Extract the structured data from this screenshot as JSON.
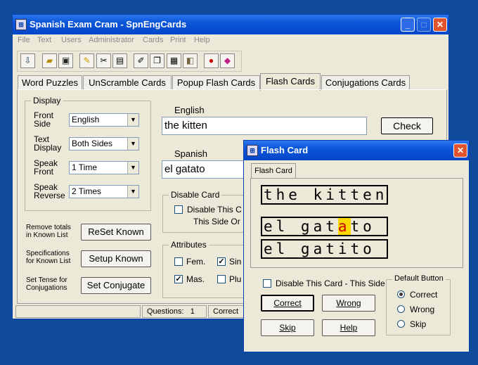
{
  "main": {
    "title": "Spanish Exam Cram - SpnEngCards",
    "menu": [
      "File",
      "Text",
      "Users",
      "Administrator",
      "Cards",
      "Print",
      "Help"
    ],
    "tabs": [
      "Word Puzzles",
      "UnScramble Cards",
      "Popup Flash Cards",
      "Flash Cards",
      "Conjugations Cards"
    ],
    "display": {
      "label": "Display",
      "front_side_label": "Front\nSide",
      "front_side_value": "English",
      "text_display_label": "Text\nDisplay",
      "text_display_value": "Both Sides",
      "speak_front_label": "Speak\nFront",
      "speak_front_value": "1 Time",
      "speak_reverse_label": "Speak\nReverse",
      "speak_reverse_value": "2 Times"
    },
    "known": {
      "remove_label": "Remove totals\nin Known List",
      "reset_button": "ReSet Known",
      "spec_label": "Specifications\nfor Known List",
      "setup_button": "Setup Known",
      "tense_label": "Set Tense for\nConjugations",
      "conjugate_button": "Set Conjugate"
    },
    "english_label": "English",
    "english_value": "the kitten",
    "check_button": "Check",
    "spanish_label": "Spanish",
    "spanish_value": "el gatato",
    "disable_card": {
      "label": "Disable Card",
      "text_line1": "Disable This C",
      "text_line2": "This Side Or"
    },
    "attributes": {
      "label": "Attributes",
      "fem": "Fem.",
      "sing": "Sin",
      "mas": "Mas.",
      "plural": "Plu"
    },
    "status": {
      "questions_label": "Questions:",
      "questions_value": "1",
      "correct_label": "Correct"
    }
  },
  "dialog": {
    "title": "Flash Card",
    "tab": "Flash Card",
    "card_english": "the kitten",
    "card_spanish_pre": "el gat",
    "card_spanish_hl": "a",
    "card_spanish_post": "to",
    "card_correct": "el gatito",
    "disable_label": "Disable This Card  - This Side",
    "correct_button": "Correct",
    "wrong_button": "Wrong",
    "skip_button": "Skip",
    "help_button": "Help",
    "default_group": "Default Button",
    "radio_correct": "Correct",
    "radio_wrong": "Wrong",
    "radio_skip": "Skip"
  },
  "icons": [
    "app-icon",
    "exit-icon",
    "open-folder-icon",
    "save-icon",
    "pencil-icon",
    "scissors-icon",
    "table-icon",
    "edit-icon",
    "cards-icon",
    "calculator-icon",
    "flashcard-icon",
    "traffic-light-icon",
    "book-icon"
  ]
}
